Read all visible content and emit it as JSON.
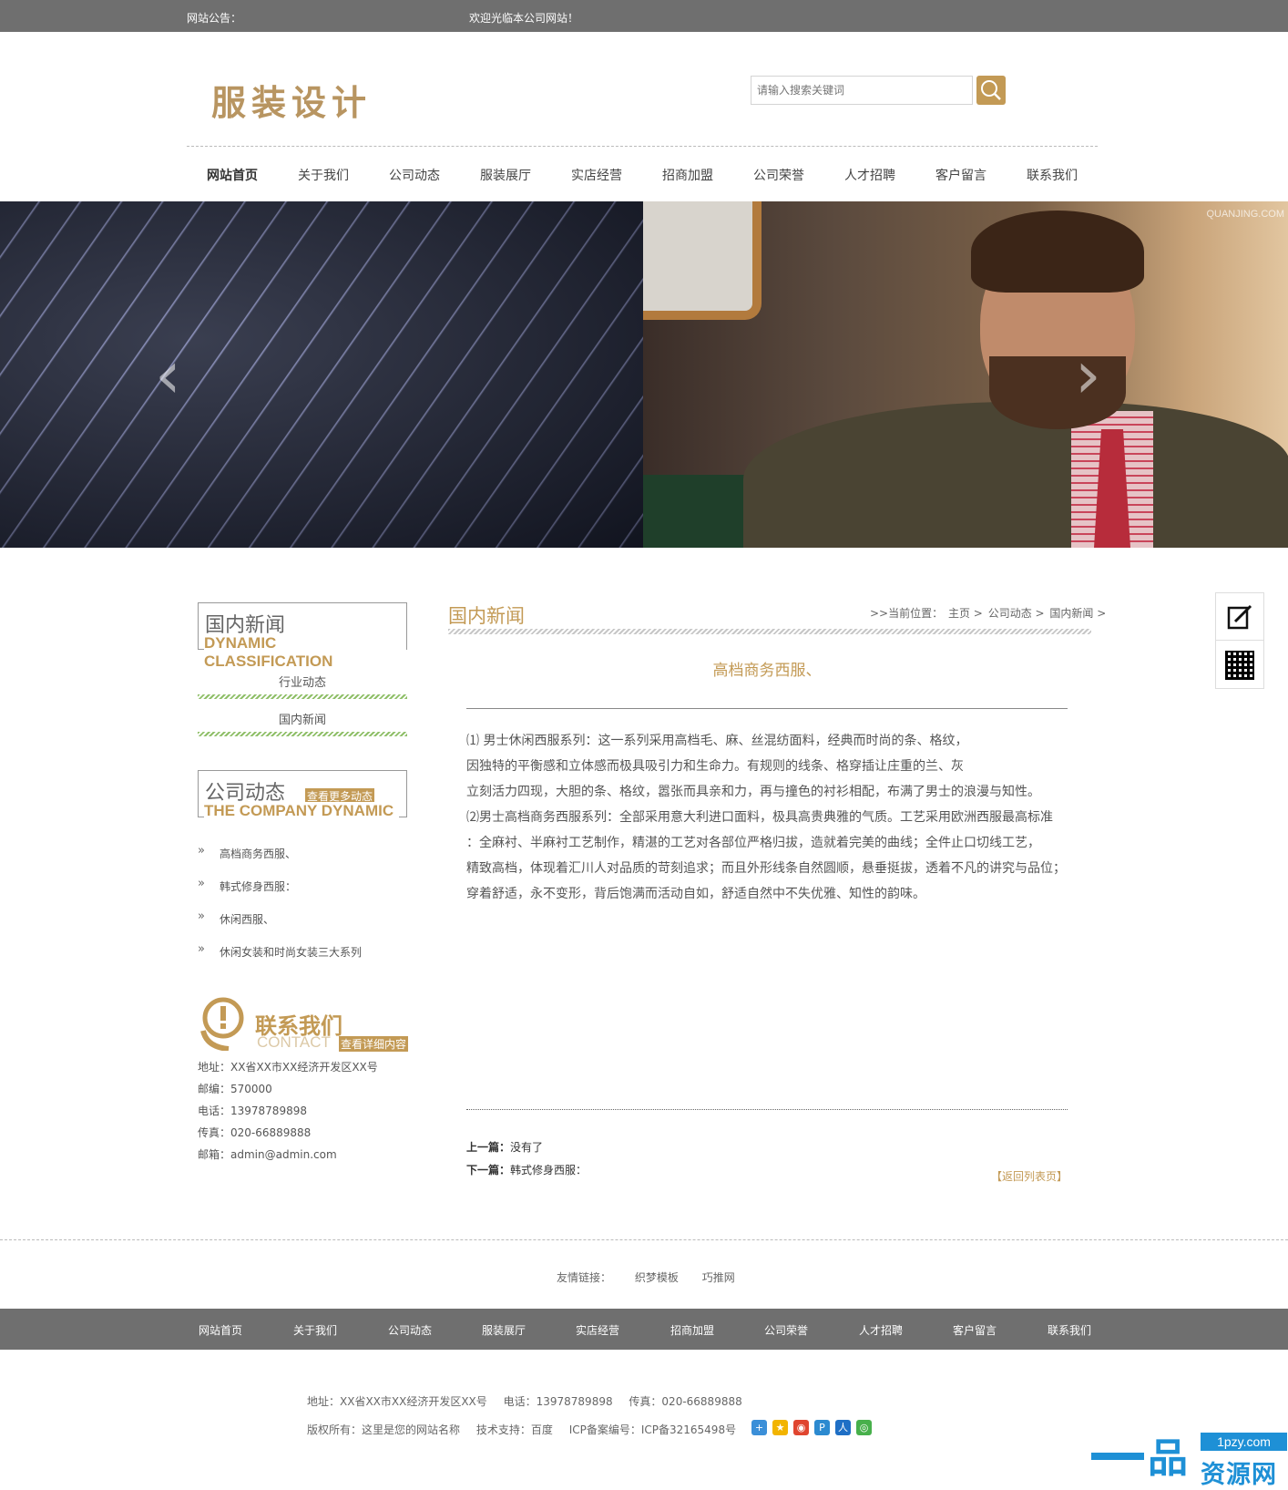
{
  "topbar": {
    "notice_label": "网站公告：",
    "notice_text": "欢迎光临本公司网站！"
  },
  "logo": {
    "text": "服装设计"
  },
  "search": {
    "placeholder": "请输入搜索关键词",
    "icon": "search-icon"
  },
  "nav": {
    "items": [
      "网站首页",
      "关于我们",
      "公司动态",
      "服装展厅",
      "实店经营",
      "招商加盟",
      "公司荣誉",
      "人才招聘",
      "客户留言",
      "联系我们"
    ],
    "active": "网站首页"
  },
  "banner": {
    "watermark": "QUANJING.COM",
    "prev_icon": "chevron-left-icon",
    "next_icon": "chevron-right-icon"
  },
  "side_tools": {
    "edit_icon": "edit-icon",
    "qr_icon": "qr-code-icon"
  },
  "sidebar": {
    "category_box": {
      "title_cn": "国内新闻",
      "title_en": "DYNAMIC CLASSIFICATION",
      "items": [
        "行业动态",
        "国内新闻"
      ]
    },
    "news_box": {
      "title_cn": "公司动态",
      "more": "查看更多动态",
      "title_en": "THE COMPANY DYNAMIC",
      "items": [
        "高档商务西服、",
        "韩式修身西服：",
        "休闲西服、",
        "休闲女装和时尚女装三大系列"
      ]
    },
    "contact": {
      "title_cn": "联系我们",
      "title_en": "CONTACT",
      "more": "查看详细内容",
      "lines": [
        "地址：XX省XX市XX经济开发区XX号",
        "邮编：570000",
        "电话：13978789898",
        "传真：020-66889888",
        "邮箱：admin@admin.com"
      ]
    }
  },
  "main": {
    "title": "国内新闻",
    "breadcrumb": [
      ">>当前位置：",
      "主页",
      ">",
      "公司动态",
      ">",
      "国内新闻",
      ">"
    ],
    "article_title": "高档商务西服、",
    "body": [
      "⑴ 男士休闲西服系列：这一系列采用高档毛、麻、丝混纺面料，经典而时尚的条、格纹，",
      "因独特的平衡感和立体感而极具吸引力和生命力。有规则的线条、格穿插让庄重的兰、灰",
      "立刻活力四现，大胆的条、格纹，嚣张而具亲和力，再与撞色的衬衫相配，布满了男士的浪漫与知性。",
      "⑵男士高档商务西服系列：全部采用意大利进口面料，极具高贵典雅的气质。工艺采用欧洲西服最高标准",
      "：全麻衬、半麻衬工艺制作，精湛的工艺对各部位严格归拔，造就着完美的曲线；全件止口切线工艺，",
      "精致高档，体现着汇川人对品质的苛刻追求；而且外形线条自然圆顺，悬垂挺拔，透着不凡的讲究与品位；",
      "穿着舒适，永不变形，背后饱满而活动自如，舒适自然中不失优雅、知性的韵味。"
    ],
    "prev_label": "上一篇：",
    "prev_value": "没有了",
    "next_label": "下一篇：",
    "next_value": "韩式修身西服：",
    "back": "【返回列表页】"
  },
  "links": {
    "label": "友情链接：",
    "items": [
      "织梦模板",
      "巧推网"
    ]
  },
  "footnav": {
    "items": [
      "网站首页",
      "关于我们",
      "公司动态",
      "服装展厅",
      "实店经营",
      "招商加盟",
      "公司荣誉",
      "人才招聘",
      "客户留言",
      "联系我们"
    ]
  },
  "footer": {
    "line1": [
      "地址：XX省XX市XX经济开发区XX号",
      "电话：13978789898",
      "传真：020-66889888"
    ],
    "line2": [
      "版权所有：这里是您的网站名称",
      "技术支持：百度",
      "ICP备案编号：ICP备32165498号"
    ],
    "share_icons": [
      "share-more-icon",
      "qzone-icon",
      "weibo-icon",
      "tencent-weibo-icon",
      "renren-icon",
      "wechat-icon"
    ]
  },
  "brand": {
    "url": "1pzy.com",
    "pin": "品",
    "text": "资源网"
  },
  "colors": {
    "accent": "#c39a55",
    "topbar": "#6f6f6f",
    "green": "#8fbf68"
  }
}
